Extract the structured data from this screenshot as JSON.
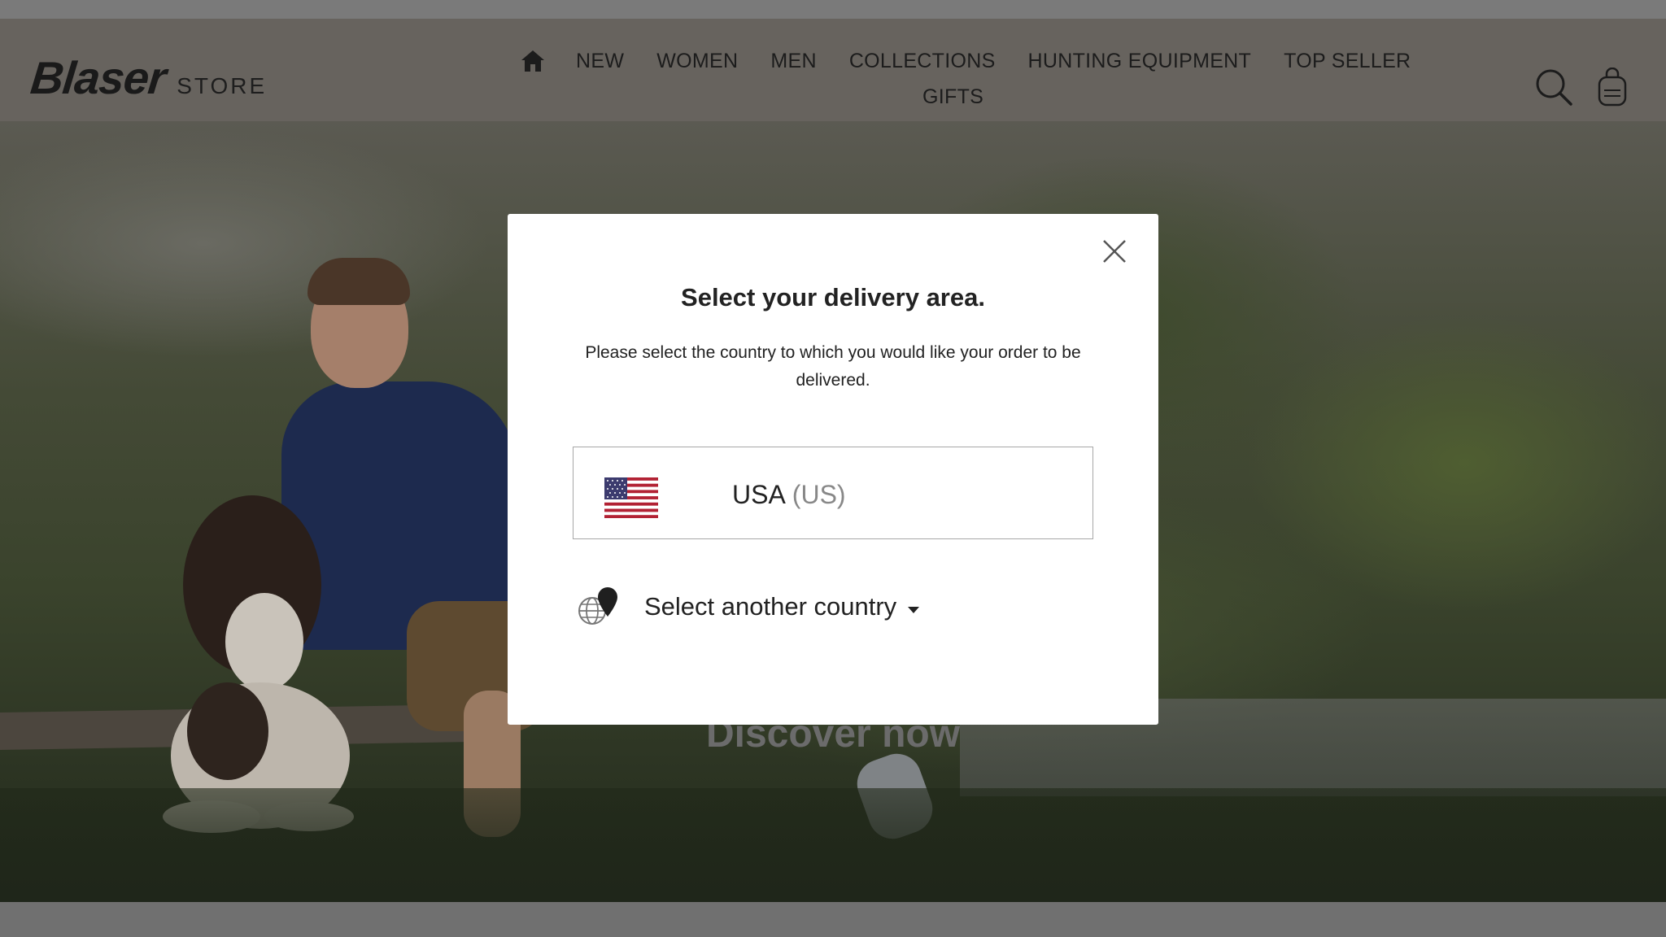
{
  "header": {
    "brand": "Blaser",
    "brand_suffix": "STORE",
    "nav": [
      {
        "label": "NEW"
      },
      {
        "label": "WOMEN"
      },
      {
        "label": "MEN"
      },
      {
        "label": "COLLECTIONS"
      },
      {
        "label": "HUNTING EQUIPMENT"
      },
      {
        "label": "TOP SELLER"
      }
    ],
    "nav_row2": "GIFTS",
    "icons": [
      "home-icon",
      "search-icon",
      "shopping-bag-icon"
    ]
  },
  "hero": {
    "cta": "Discover now"
  },
  "modal": {
    "title": "Select your delivery area.",
    "description": "Please select the country to which you would like your order to be delivered.",
    "suggested_country": {
      "name": "USA",
      "code": "(US)",
      "flag": "us-flag-icon"
    },
    "other_country_label": "Select another country",
    "icons": [
      "close-icon",
      "globe-pin-icon",
      "caret-down-icon"
    ]
  },
  "colors": {
    "header_bg": "#67635e",
    "modal_bg": "#ffffff",
    "text_dark": "#222222",
    "text_muted": "#888888",
    "border": "#a8a8a8"
  }
}
